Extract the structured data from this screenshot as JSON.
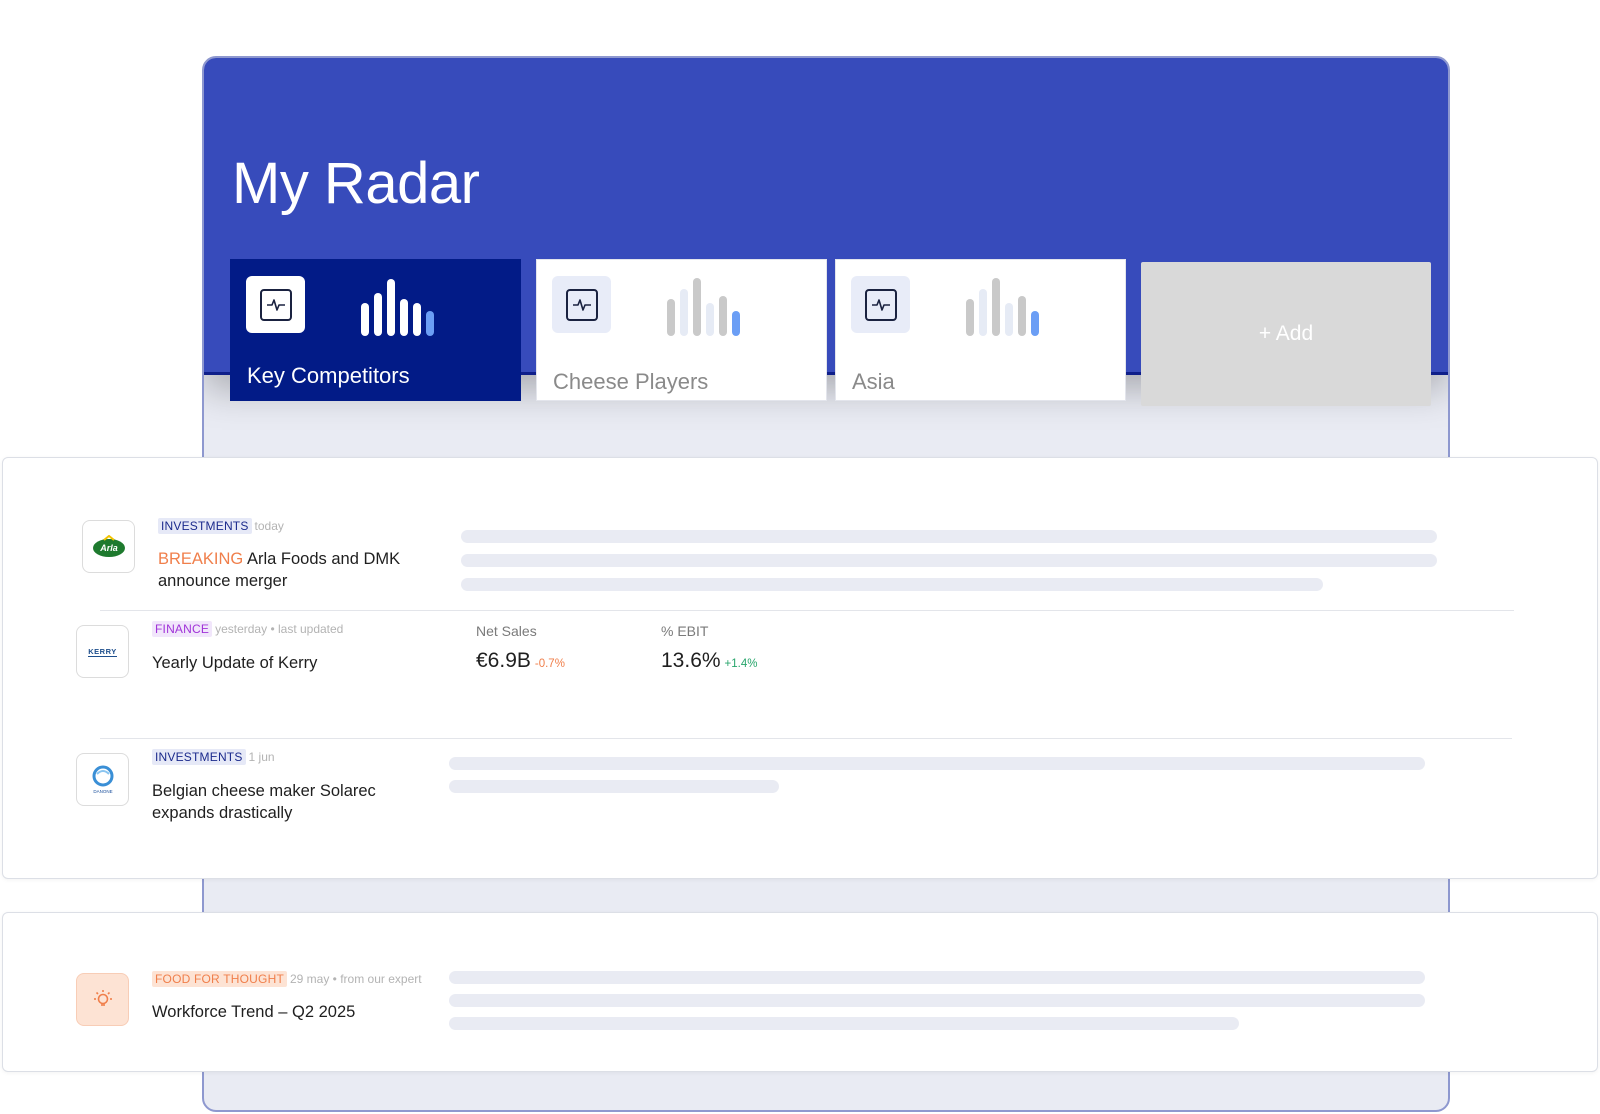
{
  "page": {
    "title": "My Radar"
  },
  "radars": [
    {
      "label": "Key Competitors",
      "active": true,
      "icon": "pulse-icon",
      "bars": [
        {
          "h": 0.55,
          "color": "#ffffff"
        },
        {
          "h": 0.72,
          "color": "#ffffff"
        },
        {
          "h": 0.95,
          "color": "#ffffff"
        },
        {
          "h": 0.62,
          "color": "#ffffff"
        },
        {
          "h": 0.55,
          "color": "#ffffff"
        },
        {
          "h": 0.42,
          "color": "#6b9ef5"
        }
      ]
    },
    {
      "label": "Cheese Players",
      "active": false,
      "icon": "pulse-icon",
      "bars": [
        {
          "h": 0.62,
          "color": "#c9c9c9"
        },
        {
          "h": 0.78,
          "color": "#e6ebf5"
        },
        {
          "h": 0.97,
          "color": "#c9c9c9"
        },
        {
          "h": 0.55,
          "color": "#e6ebf5"
        },
        {
          "h": 0.66,
          "color": "#c9c9c9"
        },
        {
          "h": 0.42,
          "color": "#6b9ef5"
        }
      ]
    },
    {
      "label": "Asia",
      "active": false,
      "icon": "pulse-icon",
      "bars": [
        {
          "h": 0.62,
          "color": "#c9c9c9"
        },
        {
          "h": 0.78,
          "color": "#e6ebf5"
        },
        {
          "h": 0.97,
          "color": "#c9c9c9"
        },
        {
          "h": 0.55,
          "color": "#e6ebf5"
        },
        {
          "h": 0.66,
          "color": "#c9c9c9"
        },
        {
          "h": 0.42,
          "color": "#6b9ef5"
        }
      ]
    }
  ],
  "add_card": {
    "label": "+ Add"
  },
  "feed": {
    "item1": {
      "logo": "Arla",
      "tag": "INVESTMENTS",
      "date": "today",
      "breaking": "BREAKING",
      "title": "Arla Foods and DMK announce merger"
    },
    "item2": {
      "logo": "KERRY",
      "tag": "FINANCE",
      "date": "yesterday • last updated",
      "title": "Yearly Update of Kerry",
      "kpis": [
        {
          "label": "Net Sales",
          "value": "€6.9B",
          "delta": "-0.7%"
        },
        {
          "label": "% EBIT",
          "value": "13.6%",
          "delta": "+1.4%"
        }
      ]
    },
    "item3": {
      "logo": "DANONE",
      "tag": "INVESTMENTS",
      "date": "1 jun",
      "title": "Belgian cheese maker Solarec expands drastically"
    }
  },
  "thought": {
    "icon": "lightbulb-icon",
    "tag": "FOOD FOR THOUGHT",
    "date": "29 may • from our expert",
    "title": "Workforce Trend – Q2 2025"
  }
}
